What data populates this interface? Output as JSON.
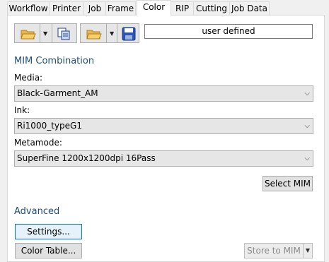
{
  "tabs": [
    {
      "label": "Workflow"
    },
    {
      "label": "Printer"
    },
    {
      "label": "Job"
    },
    {
      "label": "Frame"
    },
    {
      "label": "Color"
    },
    {
      "label": "RIP"
    },
    {
      "label": "Cutting"
    },
    {
      "label": "Job Data"
    }
  ],
  "toolbar": {
    "preset_value": "user defined"
  },
  "mim": {
    "title": "MIM Combination",
    "media_label": "Media:",
    "media_value": "Black-Garment_AM",
    "ink_label": "Ink:",
    "ink_value": "Ri1000_typeG1",
    "metamode_label": "Metamode:",
    "metamode_value": "SuperFine 1200x1200dpi 16Pass",
    "select_button": "Select MIM"
  },
  "advanced": {
    "title": "Advanced",
    "settings_button": "Settings...",
    "color_table_button": "Color Table...",
    "store_button": "Store to MIM"
  },
  "colors": {
    "accent": "#1e4e79",
    "focus": "#0078d7"
  },
  "icons": [
    "open-folder-icon",
    "copy-icon",
    "open-folder-icon",
    "save-icon",
    "chevron-down-icon"
  ]
}
